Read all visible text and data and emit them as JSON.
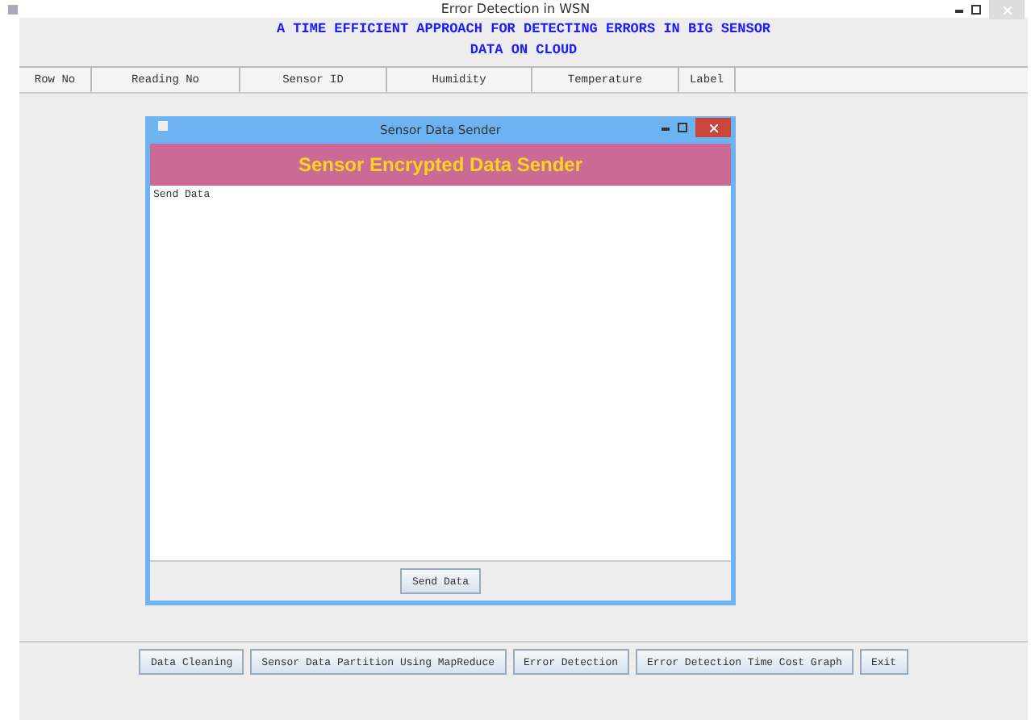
{
  "window": {
    "title": "Error Detection in WSN"
  },
  "heading": "A TIME EFFICIENT APPROACH FOR DETECTING ERRORS IN BIG SENSOR DATA ON CLOUD",
  "table": {
    "columns": [
      "Row No",
      "Reading No",
      "Sensor ID",
      "Humidity",
      "Temperature",
      "Label"
    ]
  },
  "dialog": {
    "title": "Sensor Data Sender",
    "banner": "Sensor Encrypted Data Sender",
    "log": "Send Data",
    "button": "Send Data"
  },
  "buttons": [
    "Data Cleaning",
    "Sensor Data Partition Using MapReduce",
    "Error Detection",
    "Error Detection Time Cost Graph",
    "Exit"
  ]
}
